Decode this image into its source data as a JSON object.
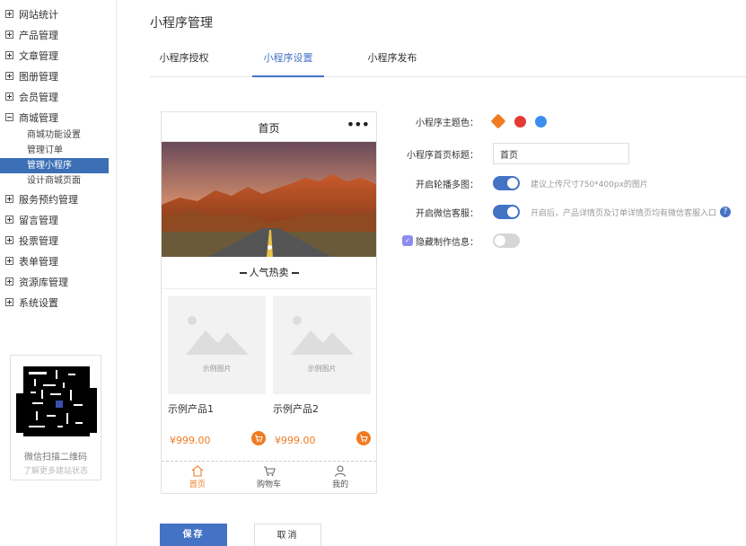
{
  "sidebar": {
    "menu": [
      {
        "label": "网站统计",
        "expanded": false
      },
      {
        "label": "产品管理",
        "expanded": false
      },
      {
        "label": "文章管理",
        "expanded": false
      },
      {
        "label": "图册管理",
        "expanded": false
      },
      {
        "label": "会员管理",
        "expanded": false
      },
      {
        "label": "商城管理",
        "expanded": true
      },
      {
        "label": "服务预约管理",
        "expanded": false
      },
      {
        "label": "留言管理",
        "expanded": false
      },
      {
        "label": "投票管理",
        "expanded": false
      },
      {
        "label": "表单管理",
        "expanded": false
      },
      {
        "label": "资源库管理",
        "expanded": false
      },
      {
        "label": "系统设置",
        "expanded": false
      }
    ],
    "submenu": [
      {
        "label": "商城功能设置"
      },
      {
        "label": "管理订单"
      },
      {
        "label": "管理小程序"
      },
      {
        "label": "设计商城页面"
      }
    ],
    "qr": {
      "title": "微信扫描二维码",
      "subtitle": "了解更多建站状态"
    }
  },
  "main": {
    "title": "小程序管理",
    "tabs": [
      {
        "label": "小程序授权"
      },
      {
        "label": "小程序设置"
      },
      {
        "label": "小程序发布"
      }
    ],
    "active_tab": "小程序设置"
  },
  "phone": {
    "title": "首页",
    "more": "•••",
    "section_title": "人气热卖",
    "products": [
      {
        "name": "示例产品1",
        "price": "¥999.00",
        "image_label": "示例图片"
      },
      {
        "name": "示例产品2",
        "price": "¥999.00",
        "image_label": "示例图片"
      }
    ],
    "nav": [
      {
        "label": "首页"
      },
      {
        "label": "购物车"
      },
      {
        "label": "我的"
      }
    ]
  },
  "settings": {
    "theme_label": "小程序主题色：",
    "theme_colors": [
      "#f07b22",
      "#e53935",
      "#3a8ef0"
    ],
    "title_label": "小程序首页标题：",
    "title_value": "首页",
    "carousel_label": "开启轮播多图：",
    "carousel_on": true,
    "carousel_hint": "建议上传尺寸750*400px的图片",
    "service_label": "开启微信客服：",
    "service_on": true,
    "service_hint": "开启后，产品详情页及订单详情页均有微信客服入口",
    "help_glyph": "?",
    "hide_label": "隐藏制作信息：",
    "hide_on": false
  },
  "buttons": {
    "save": "保存",
    "cancel": "取消"
  },
  "colors": {
    "accent": "#4472c4",
    "orange": "#f07b22",
    "active_sidebar": "#3c6fb5"
  }
}
